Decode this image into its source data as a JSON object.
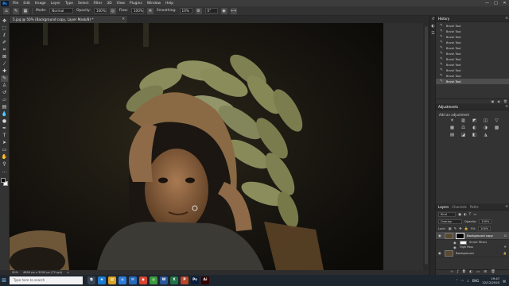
{
  "app": {
    "logo": "Ps"
  },
  "menu": {
    "items": [
      "File",
      "Edit",
      "Image",
      "Layer",
      "Type",
      "Select",
      "Filter",
      "3D",
      "View",
      "Plugins",
      "Window",
      "Help"
    ],
    "window_controls": [
      "—",
      "□",
      "✕"
    ]
  },
  "options": {
    "mode_label": "Mode:",
    "mode_value": "Normal",
    "opacity_label": "Opacity:",
    "opacity_value": "100%",
    "flow_label": "Flow:",
    "flow_value": "100%",
    "smoothing_label": "Smoothing:",
    "smoothing_value": "10%",
    "angle_value": "0°"
  },
  "document": {
    "tab_title": "5.jpg @ 50% (Background copy, Layer Mask/8) *",
    "close": "✕"
  },
  "tools": [
    "move",
    "marquee",
    "lasso",
    "quick-select",
    "crop",
    "frame",
    "eyedropper",
    "healing",
    "brush",
    "clone-stamp",
    "history-brush",
    "eraser",
    "gradient",
    "blur",
    "dodge",
    "pen",
    "type",
    "path-select",
    "rectangle",
    "hand",
    "zoom",
    "more"
  ],
  "colors": {
    "foreground": "#000000",
    "background": "#ffffff",
    "accent": "#31a8ff"
  },
  "status": {
    "zoom": "50%",
    "info": "4800 px x 3200 px (72 ppi)",
    "arrow": ">"
  },
  "history": {
    "tab": "History",
    "items": [
      "Brush Tool",
      "Brush Tool",
      "Brush Tool",
      "Brush Tool",
      "Brush Tool",
      "Brush Tool",
      "Brush Tool",
      "Brush Tool",
      "Brush Tool",
      "Brush Tool",
      "Brush Tool"
    ],
    "selected_index": 10
  },
  "adjustments": {
    "tab": "Adjustments",
    "caption": "Add an adjustment",
    "icons": [
      "☀",
      "▥",
      "◩",
      "◫",
      "▽",
      "▦",
      "⚖",
      "◐",
      "◑",
      "▩",
      "▤",
      "◪",
      "◧",
      "◮"
    ]
  },
  "layers": {
    "tabs": [
      "Layers",
      "Channels",
      "Paths"
    ],
    "kind_label": "Kind",
    "blend_value": "Overlay",
    "opacity_label": "Opacity:",
    "opacity_value": "100%",
    "lock_label": "Lock:",
    "fill_label": "Fill:",
    "fill_value": "100%",
    "rows": [
      {
        "name": "Background copy"
      },
      {
        "name": "Background"
      }
    ],
    "smart_filters": "Smart Filters",
    "high_pass": "High Pass"
  },
  "taskbar": {
    "start_icon": "⊞",
    "search_placeholder": "Type here to search",
    "apps": [
      {
        "label": "⧉",
        "color": "#3a4656"
      },
      {
        "label": "e",
        "color": "#1d7bd0"
      },
      {
        "label": "▤",
        "color": "#d9a425"
      },
      {
        "label": "⌂",
        "color": "#2f7dd9"
      },
      {
        "label": "✉",
        "color": "#2769b8"
      },
      {
        "label": "◉",
        "color": "#d9442f"
      },
      {
        "label": "◎",
        "color": "#3c9a3c"
      },
      {
        "label": "W",
        "color": "#2b579a"
      },
      {
        "label": "X",
        "color": "#217346"
      },
      {
        "label": "P",
        "color": "#b7472a"
      },
      {
        "label": "Ps",
        "color": "#0a1e3a"
      },
      {
        "label": "Ai",
        "color": "#330000"
      }
    ],
    "language": "ENG",
    "time": "19:47",
    "date": "22/12/2020"
  }
}
